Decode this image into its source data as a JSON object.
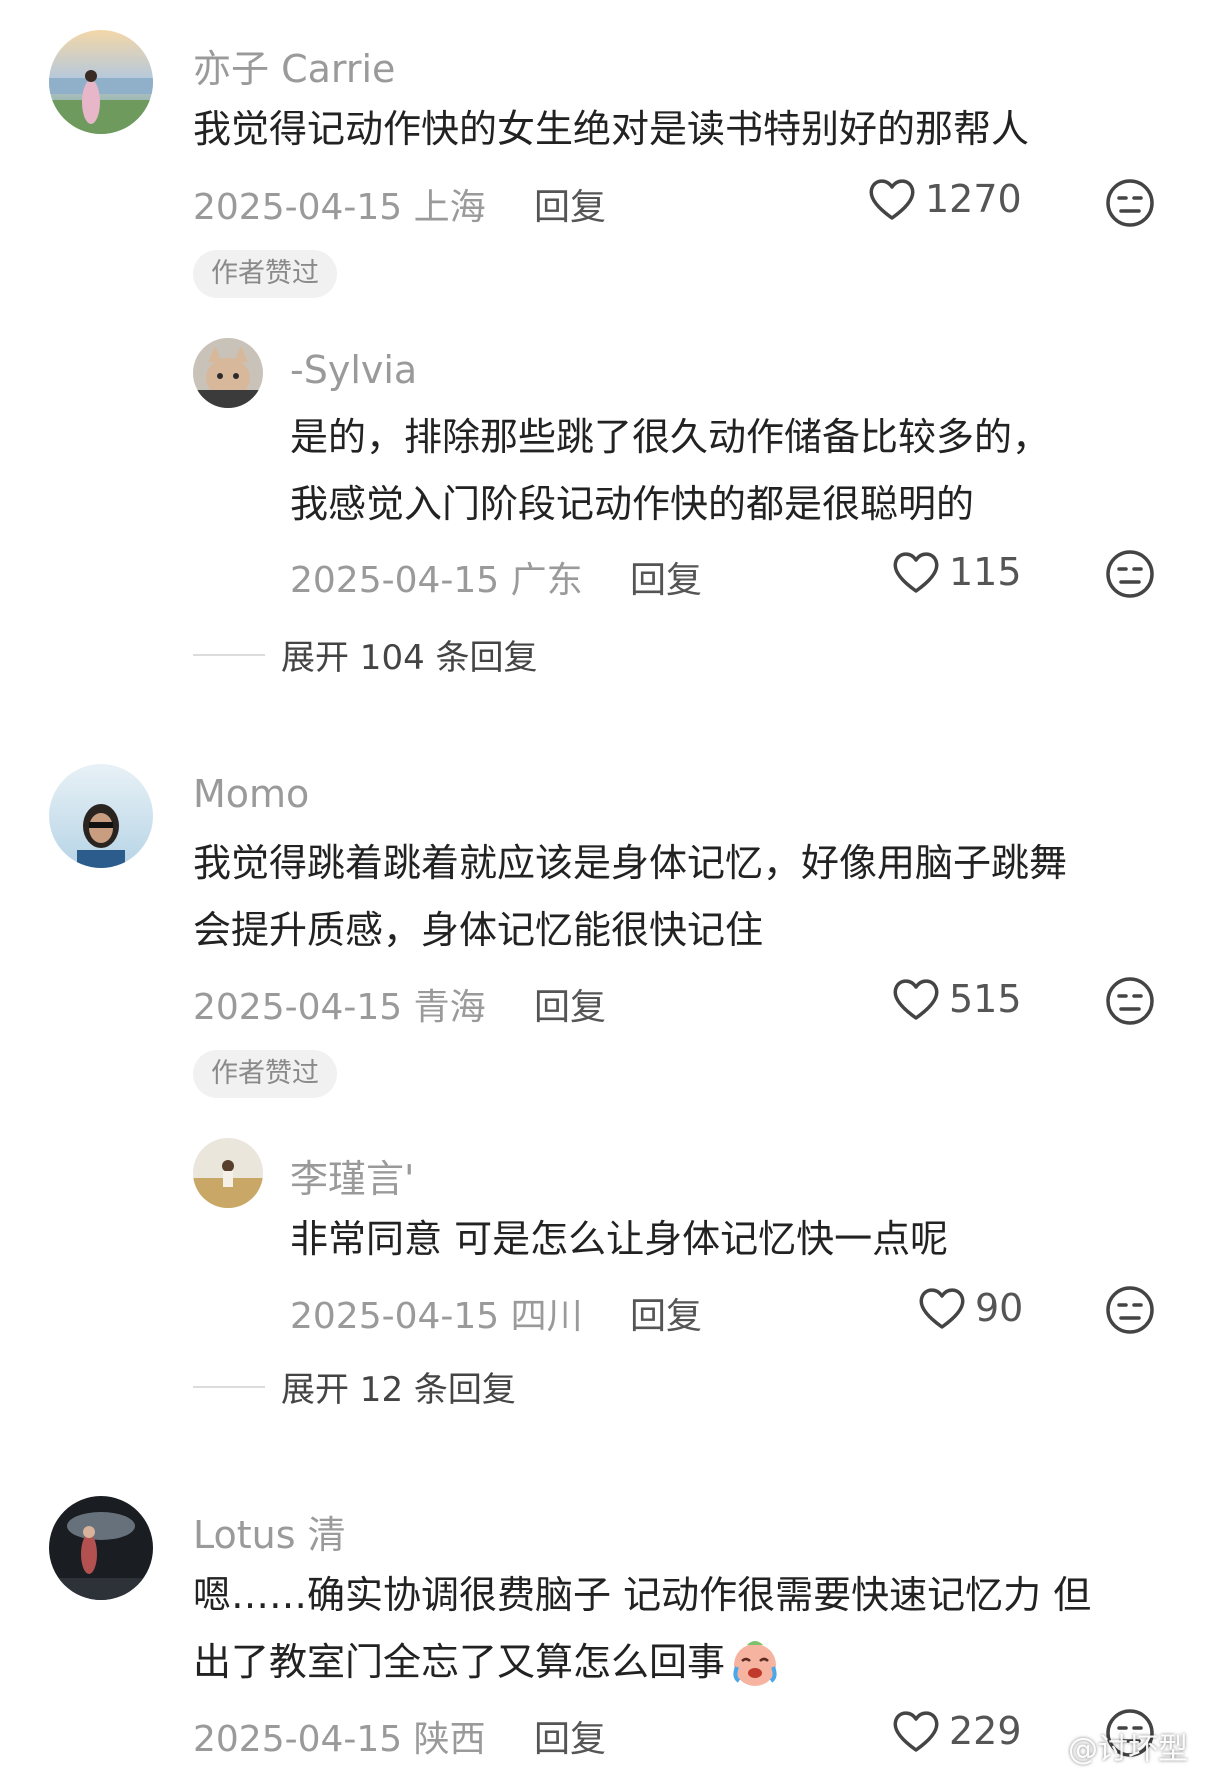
{
  "comments": [
    {
      "username": "亦子 Carrie",
      "lines": [
        "我觉得记动作快的女生绝对是读书特别好的那帮人"
      ],
      "date_location": "2025-04-15 上海",
      "reply_label": "回复",
      "likes": "1270",
      "badge": "作者赞过",
      "sub_reply": {
        "username": "-Sylvia",
        "lines": [
          "是的，排除那些跳了很久动作储备比较多的，",
          "我感觉入门阶段记动作快的都是很聪明的"
        ],
        "date_location": "2025-04-15 广东",
        "reply_label": "回复",
        "likes": "115"
      },
      "expand_label": "展开 104 条回复"
    },
    {
      "username": "Momo",
      "lines": [
        "我觉得跳着跳着就应该是身体记忆，好像用脑子跳舞",
        "会提升质感，身体记忆能很快记住"
      ],
      "date_location": "2025-04-15 青海",
      "reply_label": "回复",
      "likes": "515",
      "badge": "作者赞过",
      "sub_reply": {
        "username": "李瑾言'",
        "lines": [
          "非常同意 可是怎么让身体记忆快一点呢"
        ],
        "date_location": "2025-04-15 四川",
        "reply_label": "回复",
        "likes": "90"
      },
      "expand_label": "展开 12 条回复"
    },
    {
      "username": "Lotus 清",
      "lines": [
        "嗯……确实协调很费脑子 记动作很需要快速记忆力 但",
        "出了教室门全忘了又算怎么回事"
      ],
      "date_location": "2025-04-15 陕西",
      "reply_label": "回复",
      "likes": "229"
    }
  ],
  "watermark": "@讨坏型",
  "icons": {
    "like": "heart-outline-icon",
    "dislike": "meh-face-icon",
    "emoji": "crying-laughing-emoji-icon",
    "watermark": "weibo-logo-icon"
  }
}
